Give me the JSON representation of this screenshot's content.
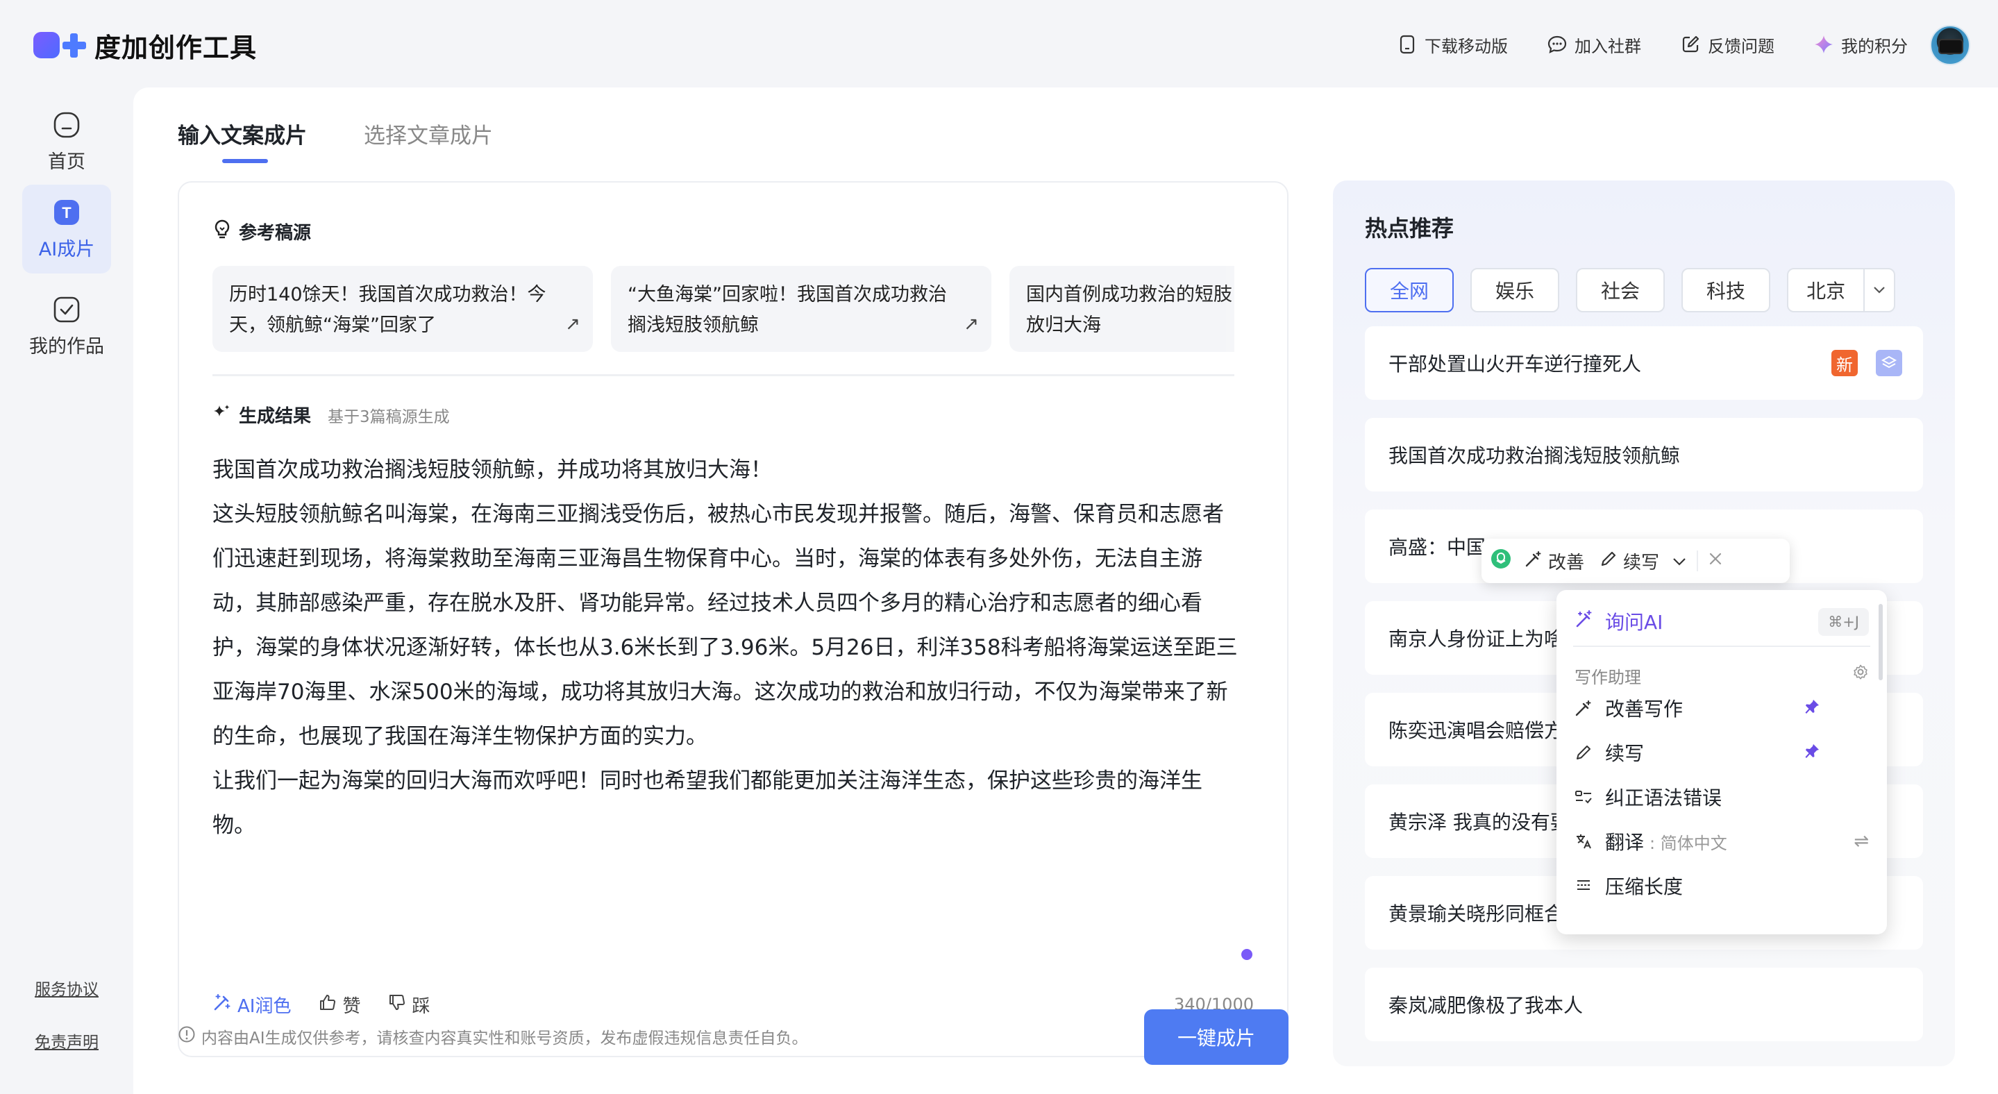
{
  "app": {
    "name": "度加创作工具"
  },
  "header": {
    "actions": [
      {
        "label": "下载移动版",
        "icon": "phone-icon"
      },
      {
        "label": "加入社群",
        "icon": "chat-bubble-icon"
      },
      {
        "label": "反馈问题",
        "icon": "edit-square-icon"
      },
      {
        "label": "我的积分",
        "icon": "sparkle-icon"
      }
    ]
  },
  "sidebar": {
    "items": [
      {
        "label": "首页",
        "icon": "home-icon"
      },
      {
        "label": "AI成片",
        "icon": "ai-video-icon",
        "active": true
      },
      {
        "label": "我的作品",
        "icon": "check-square-icon"
      }
    ],
    "footer_links": [
      "服务协议",
      "免责声明"
    ]
  },
  "main": {
    "tabs": [
      {
        "label": "输入文案成片",
        "active": true
      },
      {
        "label": "选择文章成片",
        "active": false
      }
    ],
    "reference": {
      "title": "参考稿源",
      "cards": [
        {
          "line1": "历时140馀天！我国首次成功救治！今",
          "line2": "天，领航鲸“海棠”回家了"
        },
        {
          "line1": "“大鱼海棠”回家啦！我国首次成功救治",
          "line2": "搁浅短肢领航鲸"
        },
        {
          "line1": "国内首例成功救治的短肢",
          "line2": "放归大海"
        }
      ]
    },
    "result": {
      "title": "生成结果",
      "subtitle": "基于3篇稿源生成",
      "paragraphs": [
        "我国首次成功救治搁浅短肢领航鲸，并成功将其放归大海！",
        "这头短肢领航鲸名叫海棠，在海南三亚搁浅受伤后，被热心市民发现并报警。随后，海警、保育员和志愿者们迅速赶到现场，将海棠救助至海南三亚海昌生物保育中心。当时，海棠的体表有多处外伤，无法自主游动，其肺部感染严重，存在脱水及肝、肾功能异常。经过技术人员四个多月的精心治疗和志愿者的细心看护，海棠的身体状况逐渐好转，体长也从3.6米长到了3.96米。5月26日，利洋358科考船将海棠运送至距三亚海岸70海里、水深500米的海域，成功将其放归大海。这次成功的救治和放归行动，不仅为海棠带来了新的生命，也展现了我国在海洋生物保护方面的实力。",
        "让我们一起为海棠的回归大海而欢呼吧！同时也希望我们都能更加关注海洋生态，保护这些珍贵的海洋生物。"
      ],
      "actions": {
        "polish": "AI润色",
        "like": "赞",
        "dislike": "踩"
      },
      "counter": "340/1000"
    },
    "disclaimer": "内容由AI生成仅供参考，请核查内容真实性和账号资质，发布虚假违规信息责任自负。",
    "generate_button": "一键成片"
  },
  "hot": {
    "title": "热点推荐",
    "tabs": [
      {
        "label": "全网",
        "active": true
      },
      {
        "label": "娱乐",
        "active": false
      },
      {
        "label": "社会",
        "active": false
      },
      {
        "label": "科技",
        "active": false
      },
      {
        "label": "北京",
        "active": false
      }
    ],
    "items": [
      {
        "text": "干部处置山火开车逆行撞死人",
        "badge": "新"
      },
      {
        "text": "我国首次成功救治搁浅短肢领航鲸"
      },
      {
        "text": "高盛：中国"
      },
      {
        "text": "南京人身份证上为啥"
      },
      {
        "text": "陈奕迅演唱会赔偿方"
      },
      {
        "text": "黄宗泽 我真的没有要"
      },
      {
        "text": "黄景瑜关晓彤同框合"
      },
      {
        "text": "秦岚减肥像极了我本人"
      }
    ]
  },
  "float_toolbar": {
    "improve": "改善",
    "continue": "续写"
  },
  "ai_menu": {
    "ask": "询问AI",
    "ask_shortcut": "⌘+J",
    "group_label": "写作助理",
    "items": [
      {
        "label": "改善写作",
        "pinned": true
      },
      {
        "label": "续写",
        "pinned": true
      },
      {
        "label": "纠正语法错误"
      },
      {
        "label": "翻译",
        "sub": ": 简体中文"
      },
      {
        "label": "压缩长度"
      }
    ]
  }
}
